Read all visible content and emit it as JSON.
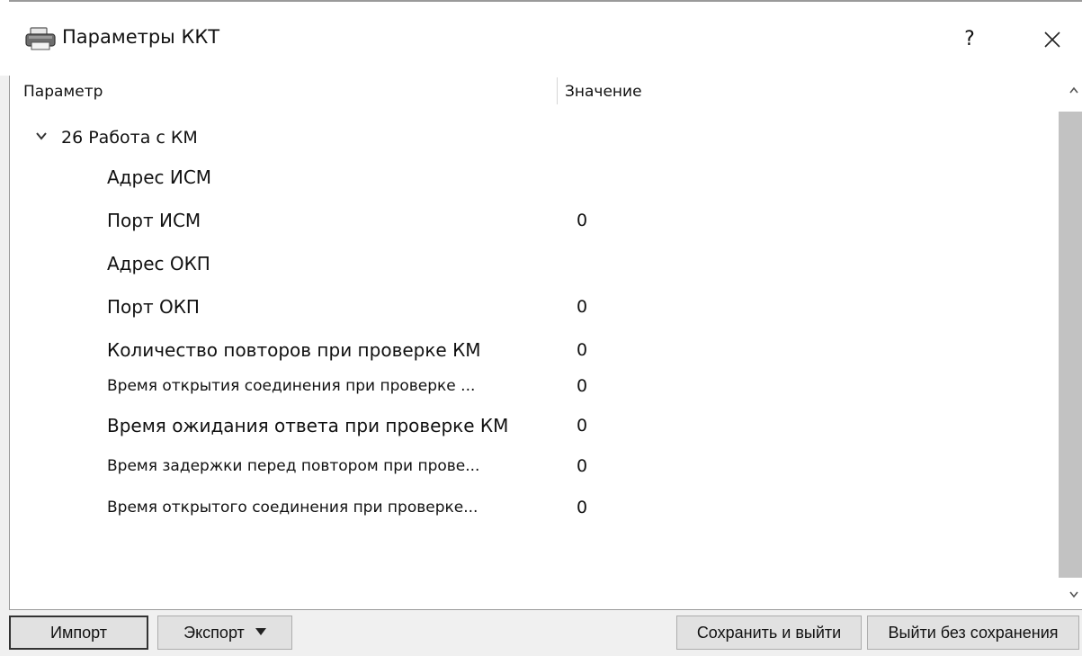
{
  "window": {
    "title": "Параметры ККТ",
    "help_label": "?",
    "icon": "printer-icon",
    "close_icon": "close-icon"
  },
  "table": {
    "columns": [
      "Параметр",
      "Значение"
    ],
    "group": {
      "label": "26 Работа с КМ",
      "expanded": true,
      "icon": "chevron-down-icon"
    },
    "rows": [
      {
        "name": "Адрес ИСМ",
        "value": ""
      },
      {
        "name": "Порт ИСМ",
        "value": "0"
      },
      {
        "name": "Адрес ОКП",
        "value": ""
      },
      {
        "name": "Порт ОКП",
        "value": "0"
      },
      {
        "name": "Количество повторов при проверке КМ",
        "value": "0"
      },
      {
        "name": "Время открытия соединения при проверке ...",
        "value": "0"
      },
      {
        "name": "Время ожидания ответа при проверке КМ",
        "value": "0"
      },
      {
        "name": "Время задержки перед повтором при прове...",
        "value": "0"
      },
      {
        "name": "Время открытого соединения при проверке...",
        "value": "0"
      }
    ]
  },
  "scrollbar": {
    "up_icon": "chevron-up-icon",
    "down_icon": "chevron-down-icon"
  },
  "buttons": {
    "import": "Импорт",
    "export": "Экспорт",
    "save_exit": "Сохранить и выйти",
    "exit_no_save": "Выйти без сохранения"
  },
  "colors": {
    "window_bg": "#f0f0f0",
    "content_bg": "#ffffff",
    "scroll_thumb": "#c2c2c2",
    "button_bg": "#e1e1e1"
  }
}
